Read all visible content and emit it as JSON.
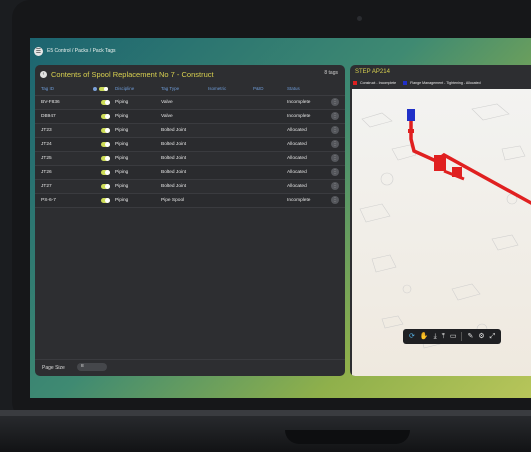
{
  "app": {
    "breadcrumb": "E5 Control / Packs / Pack Tags"
  },
  "left_panel": {
    "title": "Contents of Spool Replacement No 7 - Construct",
    "tag_count": "8 tags",
    "columns": [
      "Tag ID",
      "Discipline",
      "Tag Type",
      "Isometric",
      "P&ID",
      "Status"
    ],
    "rows": [
      {
        "tag_id": "BV-F836",
        "discipline": "Piping",
        "tag_type": "Valve",
        "status": "Incomplete"
      },
      {
        "tag_id": "DB947",
        "discipline": "Piping",
        "tag_type": "Valve",
        "status": "Incomplete"
      },
      {
        "tag_id": "JT23",
        "discipline": "Piping",
        "tag_type": "Bolted Joint",
        "status": "Allocated"
      },
      {
        "tag_id": "JT24",
        "discipline": "Piping",
        "tag_type": "Bolted Joint",
        "status": "Allocated"
      },
      {
        "tag_id": "JT25",
        "discipline": "Piping",
        "tag_type": "Bolted Joint",
        "status": "Allocated"
      },
      {
        "tag_id": "JT26",
        "discipline": "Piping",
        "tag_type": "Bolted Joint",
        "status": "Allocated"
      },
      {
        "tag_id": "JT27",
        "discipline": "Piping",
        "tag_type": "Bolted Joint",
        "status": "Allocated"
      },
      {
        "tag_id": "PS-6-7",
        "discipline": "Piping",
        "tag_type": "Pipe Spool",
        "status": "Incomplete"
      }
    ],
    "footer": {
      "page_size_label": "Page Size",
      "page_size_value": "8"
    }
  },
  "right_panel": {
    "title": "STEP AP214",
    "legend": [
      {
        "label": "Construct - Incomplete",
        "color": "#e02020"
      },
      {
        "label": "Flange Management - Tightening - Allocated",
        "color": "#2030c8"
      }
    ]
  },
  "toolbar_icons": [
    "orbit-icon",
    "pan-hand-icon",
    "move-down-icon",
    "move-up-icon",
    "camera-icon",
    "pencil-icon",
    "settings-icon",
    "expand-icon"
  ]
}
